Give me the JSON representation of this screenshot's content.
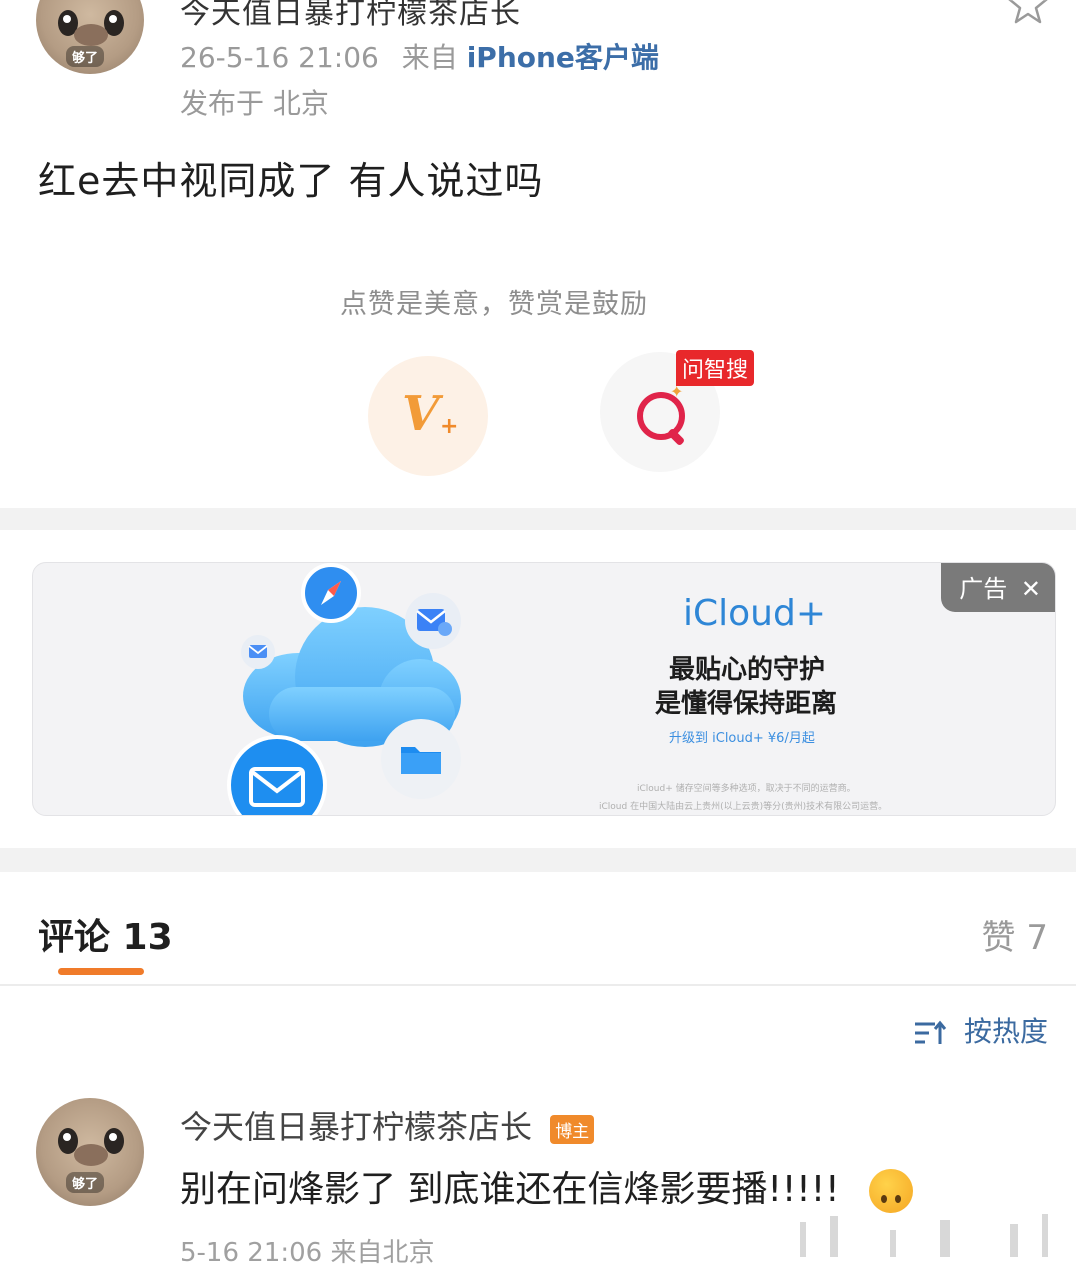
{
  "post": {
    "author": "今天值日暴打柠檬茶店长",
    "time": "26-5-16 21:06",
    "source_prefix": "来自",
    "source": "iPhone客户端",
    "location": "发布于 北京",
    "avatar_tag": "够了",
    "text": "红e去中视同成了 有人说过吗"
  },
  "reward": {
    "hint": "点赞是美意，赞赏是鼓励",
    "vplus_icon": "V",
    "search_badge": "问智搜"
  },
  "ad": {
    "badge": "广告",
    "title": "iCloud+",
    "line1": "最贴心的守护",
    "line2": "是懂得保持距离",
    "cta": "升级到 iCloud+ ¥6/月起",
    "fine1": "iCloud+ 储存空间等多种选项，取决于不同的运营商。",
    "fine2": "iCloud 在中国大陆由云上贵州(以上云贵)等分(贵州)技术有限公司运营。"
  },
  "comments_header": {
    "comments_tab": "评论 13",
    "likes_tab": "赞 7",
    "sort_label": "按热度"
  },
  "comment": {
    "author": "今天值日暴打柠檬茶店长",
    "badge": "博主",
    "avatar_tag": "够了",
    "text": "别在问烽影了 到底谁还在信烽影要播!!!!!",
    "meta": "5-16 21:06 来自北京"
  },
  "colors": {
    "accent_orange": "#f07b2a",
    "link_blue": "#3c6ea8",
    "badge_red": "#e8282b"
  }
}
